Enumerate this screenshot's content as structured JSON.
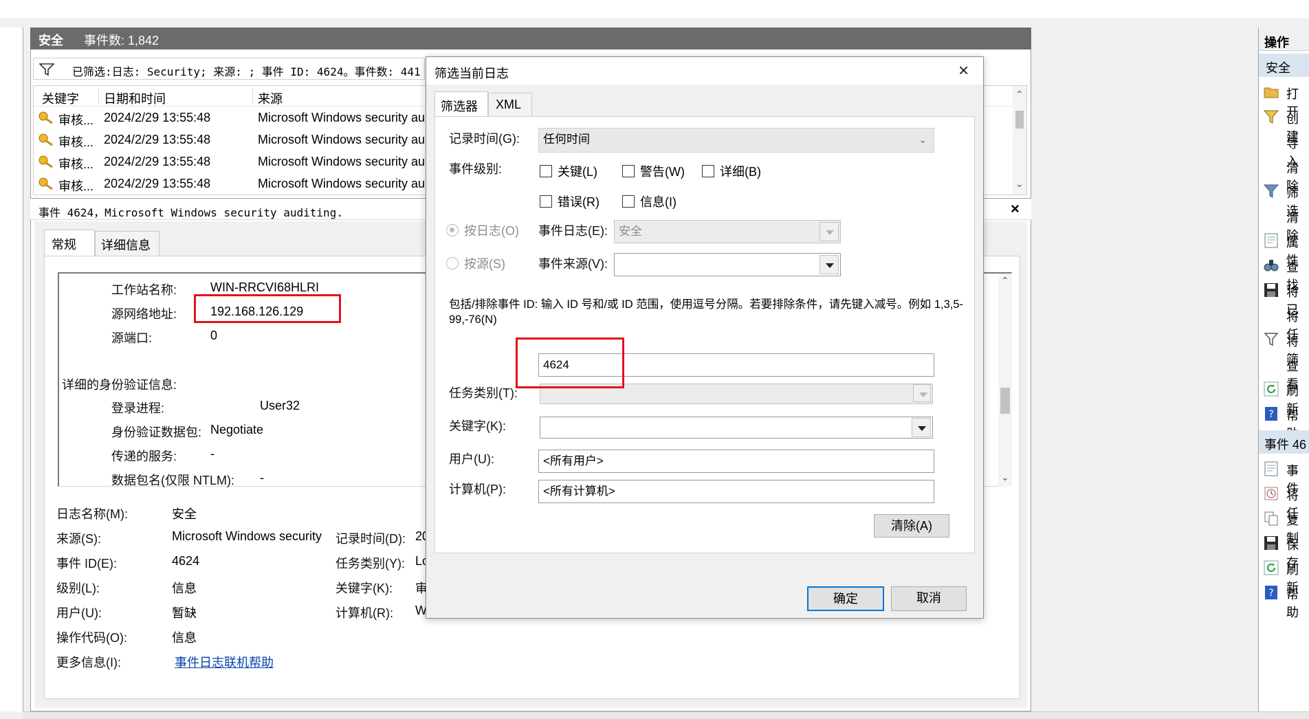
{
  "main": {
    "header": {
      "title": "安全",
      "count_label": "事件数: 1,842"
    },
    "filter_text": "已筛选:日志: Security; 来源: ; 事件 ID: 4624。事件数: 441",
    "columns": [
      "关键字",
      "日期和时间",
      "来源"
    ],
    "rows": [
      {
        "keyword": "审核...",
        "datetime": "2024/2/29 13:55:48",
        "source": "Microsoft Windows security au"
      },
      {
        "keyword": "审核...",
        "datetime": "2024/2/29 13:55:48",
        "source": "Microsoft Windows security au"
      },
      {
        "keyword": "审核...",
        "datetime": "2024/2/29 13:55:48",
        "source": "Microsoft Windows security au"
      },
      {
        "keyword": "审核...",
        "datetime": "2024/2/29 13:55:48",
        "source": "Microsoft Windows security au"
      }
    ],
    "event_title": "事件 4624，Microsoft Windows security auditing.",
    "detail_tabs": [
      "常规",
      "详细信息"
    ],
    "detail_text": {
      "workstation_label": "工作站名称:",
      "workstation_value": "WIN-RRCVI68HLRI",
      "src_addr_label": "源网络地址:",
      "src_addr_value": "192.168.126.129",
      "src_port_label": "源端口:",
      "src_port_value": "0",
      "auth_header": "详细的身份验证信息:",
      "logon_process_label": "登录进程:",
      "logon_process_value": "User32",
      "auth_pkg_label": "身份验证数据包:",
      "auth_pkg_value": "Negotiate",
      "transited_label": "传递的服务:",
      "transited_value": "-",
      "pkg_name_label": "数据包名(仅限 NTLM):",
      "pkg_name_value": "-"
    },
    "props": {
      "log_name_label": "日志名称(M):",
      "log_name_value": "安全",
      "source_label": "来源(S):",
      "source_value": "Microsoft Windows security",
      "logged_label": "记录时间(D):",
      "logged_value": "20",
      "event_id_label": "事件 ID(E):",
      "event_id_value": "4624",
      "task_label": "任务类别(Y):",
      "task_value": "Lo",
      "level_label": "级别(L):",
      "level_value": "信息",
      "keywords_label": "关键字(K):",
      "keywords_value": "审",
      "user_label": "用户(U):",
      "user_value": "暂缺",
      "computer_label": "计算机(R):",
      "computer_value": "W",
      "opcode_label": "操作代码(O):",
      "opcode_value": "信息",
      "more_info_label": "更多信息(I):",
      "more_info_link": "事件日志联机帮助"
    }
  },
  "actions": {
    "header": "操作",
    "section1": "安全",
    "items1": [
      {
        "icon": "folder-open-icon",
        "label": "打开"
      },
      {
        "icon": "filter-icon",
        "label": "创建"
      },
      {
        "icon": "",
        "label": "导入"
      },
      {
        "icon": "",
        "label": "清除"
      },
      {
        "icon": "filter-icon",
        "label": "筛选"
      },
      {
        "icon": "",
        "label": "清除"
      },
      {
        "icon": "properties-icon",
        "label": "属性"
      },
      {
        "icon": "binoculars-icon",
        "label": "查找"
      },
      {
        "icon": "save-icon",
        "label": "将已"
      },
      {
        "icon": "",
        "label": "将任"
      },
      {
        "icon": "attach-task-icon",
        "label": "将筛"
      },
      {
        "icon": "",
        "label": "查看"
      },
      {
        "icon": "refresh-icon",
        "label": "刷新"
      },
      {
        "icon": "help-icon",
        "label": "帮助"
      }
    ],
    "section2": "事件 46",
    "items2": [
      {
        "icon": "event-properties-icon",
        "label": "事件"
      },
      {
        "icon": "attach-task-icon",
        "label": "将任"
      },
      {
        "icon": "copy-icon",
        "label": "复制"
      },
      {
        "icon": "save-icon",
        "label": "保存"
      },
      {
        "icon": "refresh-icon",
        "label": "刷新"
      },
      {
        "icon": "help-icon",
        "label": "帮助"
      }
    ]
  },
  "dialog": {
    "title": "筛选当前日志",
    "tabs": [
      "筛选器",
      "XML"
    ],
    "logged_label": "记录时间(G):",
    "logged_value": "任何时间",
    "level_label": "事件级别:",
    "levels": [
      "关键(L)",
      "警告(W)",
      "详细(B)",
      "错误(R)",
      "信息(I)"
    ],
    "by_log_label": "按日志(O)",
    "event_logs_label": "事件日志(E):",
    "event_logs_value": "安全",
    "by_source_label": "按源(S)",
    "event_sources_label": "事件来源(V):",
    "event_sources_value": "",
    "instructions": "包括/排除事件 ID: 输入 ID 号和/或 ID 范围，使用逗号分隔。若要排除条件，请先键入减号。例如 1,3,5-99,-76(N)",
    "event_id_value": "4624",
    "task_label": "任务类别(T):",
    "task_value": "",
    "keywords_label": "关键字(K):",
    "keywords_value": "",
    "user_label": "用户(U):",
    "user_value": "<所有用户>",
    "computer_label": "计算机(P):",
    "computer_value": "<所有计算机>",
    "clear_label": "清除(A)",
    "ok_label": "确定",
    "cancel_label": "取消"
  }
}
